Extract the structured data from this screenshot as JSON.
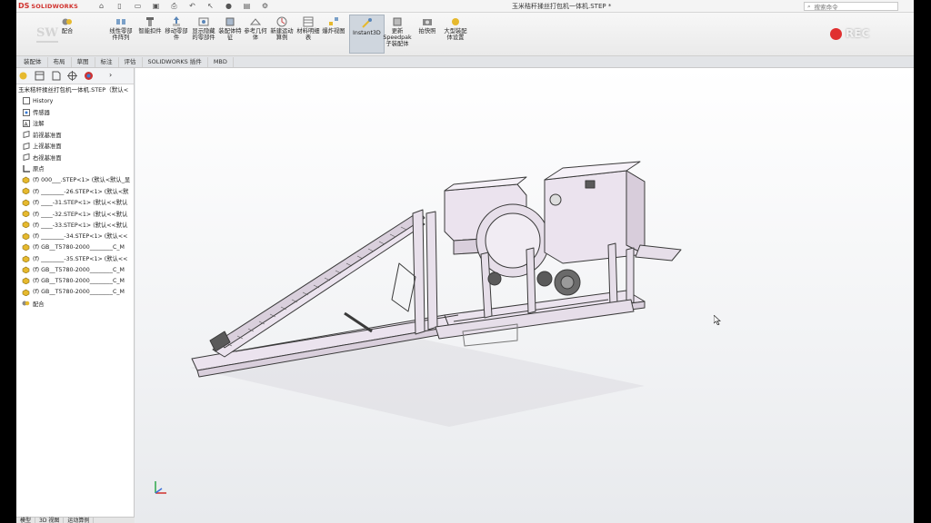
{
  "titlebar": {
    "brand_ds": "DS",
    "brand_name": "SOLIDWORKS",
    "document_title": "玉米秸秆揉丝打包机一体机.STEP *",
    "search_placeholder": "搜索命令"
  },
  "ribbon": {
    "items": [
      {
        "label": "配合"
      },
      {
        "label": "线性零部件阵列"
      },
      {
        "label": "智能扣件"
      },
      {
        "label": "移动零部件"
      },
      {
        "label": "显示隐藏的零部件"
      },
      {
        "label": "装配体特征"
      },
      {
        "label": "参考几何体"
      },
      {
        "label": "新建运动算例"
      },
      {
        "label": "材料明细表"
      },
      {
        "label": "爆炸视图"
      },
      {
        "label": "Instant3D"
      },
      {
        "label": "更新Speedpak子装配体"
      },
      {
        "label": "拍快照"
      },
      {
        "label": "大型装配体设置"
      }
    ],
    "rec_label": "REC"
  },
  "tabs": [
    "装配体",
    "布局",
    "草图",
    "标注",
    "评估",
    "SOLIDWORKS 插件",
    "MBD"
  ],
  "feature_tree": {
    "root": "玉米秸秆揉丝打包机一体机.STEP（默认<",
    "items": [
      {
        "label": "History",
        "icon": "history-icon"
      },
      {
        "label": "传感器",
        "icon": "sensor-icon"
      },
      {
        "label": "注解",
        "icon": "annotation-icon"
      },
      {
        "label": "前视基准面",
        "icon": "plane-icon"
      },
      {
        "label": "上视基准面",
        "icon": "plane-icon"
      },
      {
        "label": "右视基准面",
        "icon": "plane-icon"
      },
      {
        "label": "原点",
        "icon": "origin-icon"
      },
      {
        "label": "(f) 000___.STEP<1> (默认<默认_显",
        "icon": "part-icon"
      },
      {
        "label": "(f) ________-26.STEP<1> (默认<默",
        "icon": "part-icon"
      },
      {
        "label": "(f) ____-31.STEP<1> (默认<<默认",
        "icon": "part-icon"
      },
      {
        "label": "(f) ____-32.STEP<1> (默认<<默认",
        "icon": "part-icon"
      },
      {
        "label": "(f) ____-33.STEP<1> (默认<<默认",
        "icon": "part-icon"
      },
      {
        "label": "(f) ________-34.STEP<1> (默认<<",
        "icon": "part-icon"
      },
      {
        "label": "(f) GB__T5780-2000________C_M",
        "icon": "part-icon"
      },
      {
        "label": "(f) ________-35.STEP<1> (默认<<",
        "icon": "part-icon"
      },
      {
        "label": "(f) GB__T5780-2000________C_M",
        "icon": "part-icon"
      },
      {
        "label": "(f) GB__T5780-2000________C_M",
        "icon": "part-icon"
      },
      {
        "label": "(f) GB__T5780-2000________C_M",
        "icon": "part-icon"
      },
      {
        "label": "配合",
        "icon": "mates-icon"
      }
    ],
    "bottom_tabs": [
      "模型",
      "3D 视图",
      "运动算例"
    ]
  },
  "colors": {
    "brand_red": "#d0312d",
    "model_fill": "#e8e0ea",
    "model_stroke": "#3a3a3a",
    "record_dot": "#e03030"
  }
}
